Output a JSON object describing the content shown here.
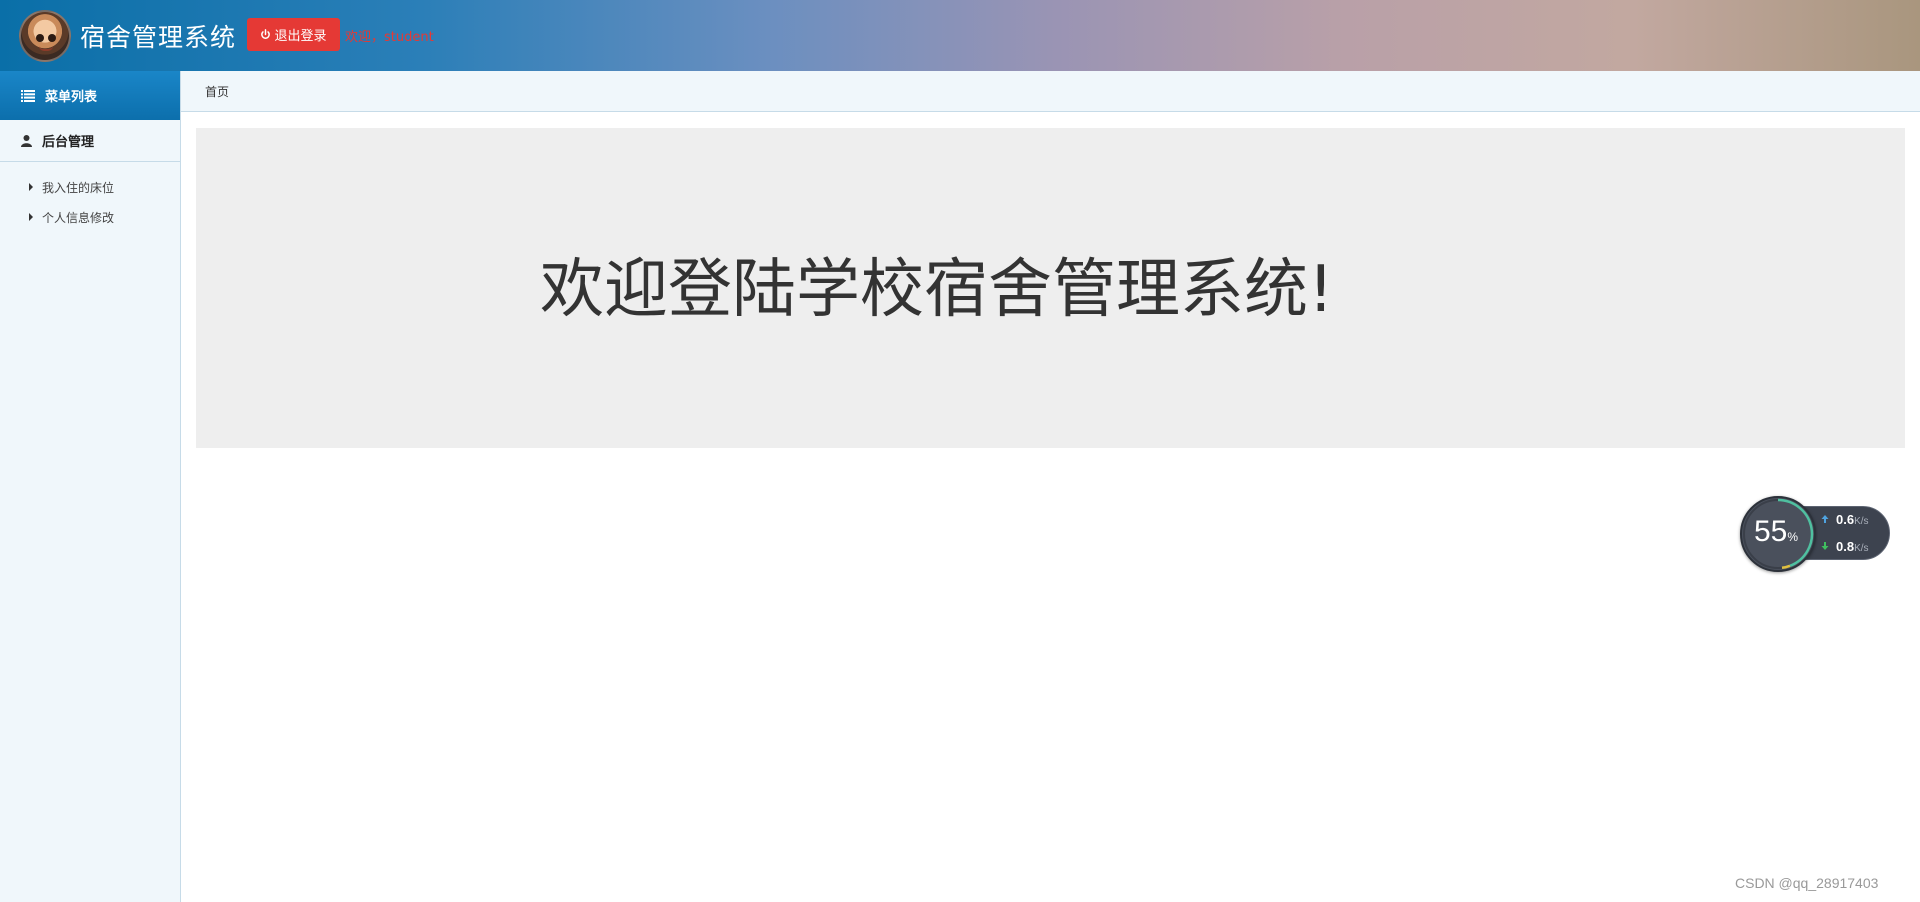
{
  "header": {
    "title": "宿舍管理系统",
    "logout_label": "退出登录",
    "welcome_text": "欢迎，student",
    "accent_color": "#e53935"
  },
  "sidebar": {
    "menu_title": "菜单列表",
    "group_label": "后台管理",
    "items": [
      {
        "label": "我入住的床位",
        "icon": "caret-right-icon"
      },
      {
        "label": "个人信息修改",
        "icon": "caret-right-icon"
      }
    ]
  },
  "breadcrumb": {
    "home": "首页"
  },
  "main": {
    "welcome_heading": "欢迎登陆学校宿舍管理系统!"
  },
  "speed_widget": {
    "percent": "55",
    "percent_unit": "%",
    "upload": "0.6",
    "download": "0.8",
    "unit": "K/s"
  },
  "watermark": "CSDN @qq_28917403"
}
